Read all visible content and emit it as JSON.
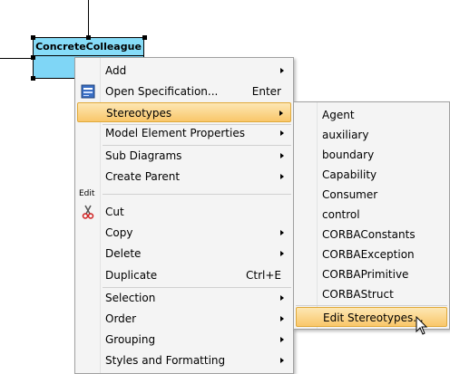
{
  "diagram": {
    "class_name": "ConcreteColleague"
  },
  "context_menu": {
    "items": [
      {
        "label": "Add",
        "shortcut": "",
        "submenu": true
      },
      {
        "label": "Open Specification...",
        "shortcut": "Enter",
        "submenu": false,
        "icon": "specification-icon"
      },
      {
        "label": "Stereotypes",
        "shortcut": "",
        "submenu": true,
        "highlighted": true
      },
      {
        "label": "Model Element Properties",
        "shortcut": "",
        "submenu": true
      },
      {
        "label": "Sub Diagrams",
        "shortcut": "",
        "submenu": true
      },
      {
        "label": "Create Parent",
        "shortcut": "",
        "submenu": true
      },
      {
        "label": "Cut",
        "shortcut": "",
        "submenu": false,
        "icon": "scissors-icon"
      },
      {
        "label": "Copy",
        "shortcut": "",
        "submenu": true
      },
      {
        "label": "Delete",
        "shortcut": "",
        "submenu": true
      },
      {
        "label": "Duplicate",
        "shortcut": "Ctrl+E",
        "submenu": false
      },
      {
        "label": "Selection",
        "shortcut": "",
        "submenu": true
      },
      {
        "label": "Order",
        "shortcut": "",
        "submenu": true
      },
      {
        "label": "Grouping",
        "shortcut": "",
        "submenu": true
      },
      {
        "label": "Styles and Formatting",
        "shortcut": "",
        "submenu": true
      }
    ],
    "group_label_edit": "Edit"
  },
  "stereotypes_submenu": {
    "items": [
      {
        "label": "Agent"
      },
      {
        "label": "auxiliary"
      },
      {
        "label": "boundary"
      },
      {
        "label": "Capability"
      },
      {
        "label": "Consumer"
      },
      {
        "label": "control"
      },
      {
        "label": "CORBAConstants"
      },
      {
        "label": "CORBAException"
      },
      {
        "label": "CORBAPrimitive"
      },
      {
        "label": "CORBAStruct"
      },
      {
        "label": "Edit Stereotypes...",
        "highlighted": true
      }
    ]
  },
  "colors": {
    "class_fill": "#7fd6f6",
    "menu_bg": "#f4f4f4",
    "highlight": "#f9c76a"
  }
}
